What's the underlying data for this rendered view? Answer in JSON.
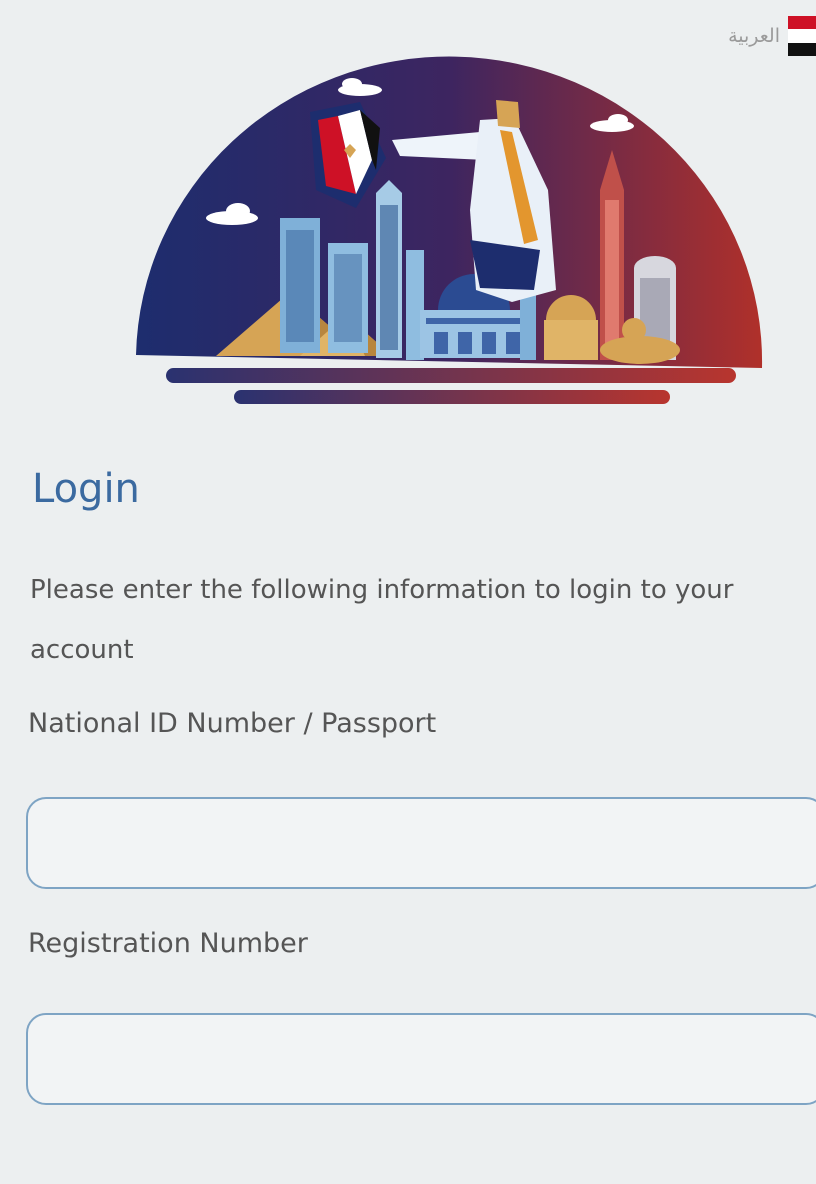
{
  "header": {
    "language_label": "العربية",
    "language_flag_icon": "egypt-flag-icon"
  },
  "hero": {
    "illustration": "cairo-skyline-illustration",
    "colors": {
      "navy": "#1d2d6e",
      "purple": "#3d2560",
      "red": "#b0302a",
      "sand": "#d6a455",
      "sky_blue": "#7fb0d8"
    }
  },
  "login": {
    "title": "Login",
    "subtitle": "Please enter the following information to login to your account",
    "national_id_label": "National ID Number / Passport",
    "national_id_value": "",
    "registration_label": "Registration Number",
    "registration_value": ""
  },
  "colors": {
    "accent": "#3b6aa0",
    "text": "#555555",
    "input_border": "#7ea4c4",
    "background": "#eceff0"
  }
}
